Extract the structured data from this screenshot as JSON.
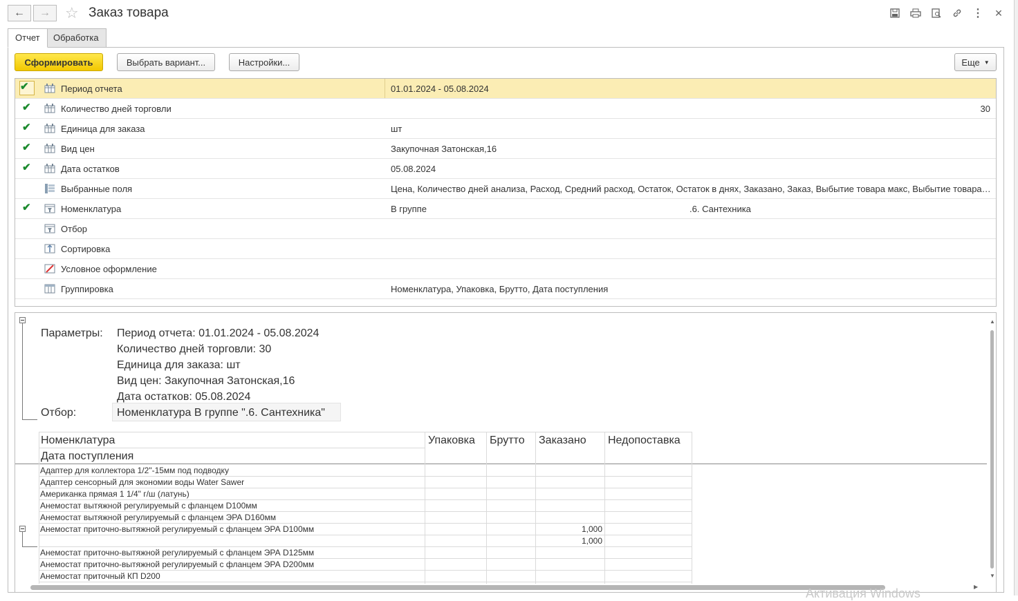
{
  "window": {
    "title": "Заказ товара",
    "icons": [
      "save-icon",
      "print-icon",
      "preview-icon",
      "link-icon",
      "more-vertical-icon",
      "close-icon"
    ]
  },
  "tabs": [
    {
      "label": "Отчет",
      "active": true
    },
    {
      "label": "Обработка",
      "active": false
    }
  ],
  "toolbar": {
    "generate_label": "Сформировать",
    "choose_variant_label": "Выбрать вариант...",
    "settings_label": "Настройки...",
    "more_label": "Еще"
  },
  "settings_rows": [
    {
      "name": "Период отчета",
      "value": "01.01.2024 - 05.08.2024",
      "checked": true,
      "selected": true
    },
    {
      "name": "Количество дней торговли",
      "value": "",
      "number": "30",
      "checked": true
    },
    {
      "name": "Единица для заказа",
      "value": "шт",
      "checked": true
    },
    {
      "name": "Вид цен",
      "value": "Закупочная Затонская,16",
      "checked": true
    },
    {
      "name": "Дата остатков",
      "value": "05.08.2024",
      "checked": true
    },
    {
      "name": "Выбранные поля",
      "value": "Цена, Количество дней анализа, Расход, Средний расход, Остаток, Остаток в днях, Заказано, Заказ, Выбытие товара макс, Выбытие товара мин, Упаковка",
      "checked": false
    },
    {
      "name": "Номенклатура",
      "value": "В группе",
      "value2": ".6. Сантехника",
      "checked": true
    },
    {
      "name": "Отбор",
      "value": "",
      "checked": false
    },
    {
      "name": "Сортировка",
      "value": "",
      "checked": false
    },
    {
      "name": "Условное оформление",
      "value": "",
      "checked": false
    },
    {
      "name": "Группировка",
      "value": "Номенклатура, Упаковка, Брутто, Дата поступления",
      "checked": false
    }
  ],
  "report": {
    "params_label": "Параметры:",
    "params": [
      "Период отчета: 01.01.2024 - 05.08.2024",
      "Количество дней торговли: 30",
      "Единица для заказа: шт",
      "Вид цен: Закупочная Затонская,16",
      "Дата остатков: 05.08.2024"
    ],
    "filter_label": "Отбор:",
    "filter_value": "Номенклатура В группе \".6. Сантехника\"",
    "columns": [
      "Номенклатура",
      "Упаковка",
      "Брутто",
      "Заказано",
      "Недопоставка"
    ],
    "subheader": "Дата поступления",
    "rows": [
      {
        "name": "Адаптер для коллектора 1/2\"-15мм под подводку",
        "ordered": ""
      },
      {
        "name": "Адаптер сенсорный для экономии воды Water Sawer",
        "ordered": ""
      },
      {
        "name": "Американка прямая 1 1/4\"  г/ш (латунь)",
        "ordered": ""
      },
      {
        "name": "Анемостат вытяжной регулируемый с фланцем D100мм",
        "ordered": ""
      },
      {
        "name": "Анемостат вытяжной регулируемый с фланцем ЭРА D160мм",
        "ordered": ""
      },
      {
        "name": "Анемостат приточно-вытяжной регулируемый с фланцем ЭРА D100мм",
        "ordered": "1,000"
      },
      {
        "name": "",
        "ordered": "1,000"
      },
      {
        "name": "Анемостат приточно-вытяжной регулируемый с фланцем ЭРА D125мм",
        "ordered": ""
      },
      {
        "name": "Анемостат приточно-вытяжной регулируемый с фланцем ЭРА D200мм",
        "ordered": ""
      },
      {
        "name": "Анемостат приточный КП D200",
        "ordered": ""
      }
    ]
  },
  "watermark": "Активация Windows"
}
